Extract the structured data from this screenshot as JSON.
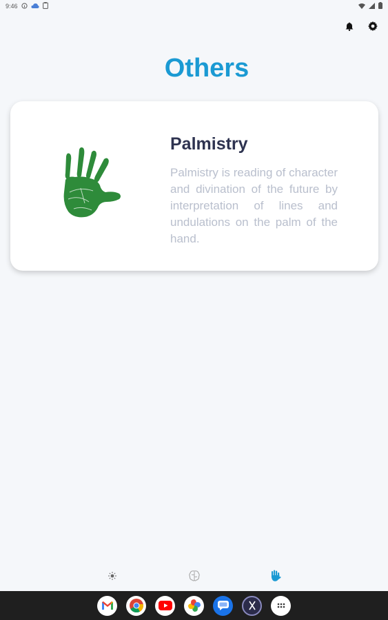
{
  "status_bar": {
    "time": "9:46"
  },
  "header": {
    "notifications_icon": "bell-icon",
    "settings_icon": "gear-icon"
  },
  "page": {
    "title": "Others",
    "title_color": "#1b9ad3"
  },
  "cards": [
    {
      "title": "Palmistry",
      "description": "Palmistry is reading of character and divination of the future by interpretation of lines and undulations on the palm of the hand.",
      "image": "green-hand-print",
      "image_color": "#2e8b3a"
    }
  ],
  "bottom_nav": {
    "items": [
      {
        "icon": "sun-icon"
      },
      {
        "icon": "brain-icon"
      },
      {
        "icon": "hand-icon",
        "active": true
      }
    ],
    "active_color": "#1b9ad3"
  },
  "taskbar": {
    "apps": [
      "gmail-icon",
      "chrome-icon",
      "youtube-icon",
      "photos-icon",
      "messages-icon",
      "app-icon",
      "app-drawer-icon"
    ]
  }
}
